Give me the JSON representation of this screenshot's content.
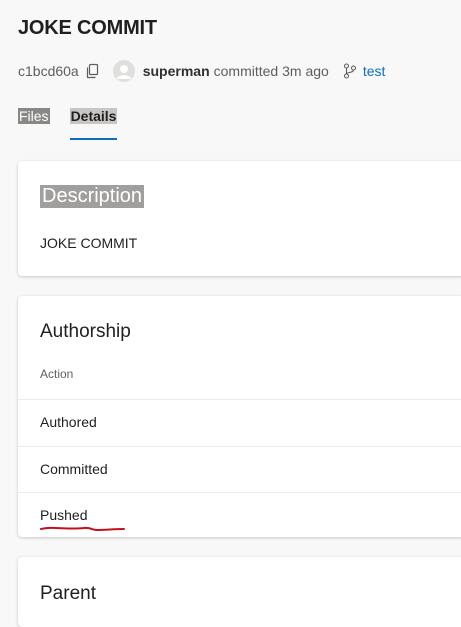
{
  "commit": {
    "title": "JOKE COMMIT",
    "hash": "c1bcd60a",
    "author": "superman",
    "action_time": "committed 3m ago",
    "branch": "test"
  },
  "tabs": [
    {
      "label": "Files"
    },
    {
      "label": "Details"
    }
  ],
  "description": {
    "heading": "Description",
    "text": "JOKE COMMIT"
  },
  "authorship": {
    "heading": "Authorship",
    "column_header": "Action",
    "rows": [
      "Authored",
      "Committed",
      "Pushed"
    ]
  },
  "parent": {
    "heading": "Parent"
  },
  "colors": {
    "accent": "#0f6cbd",
    "annotation": "#c50f1f"
  },
  "icons": {
    "copy": "copy-icon",
    "avatar": "avatar-icon",
    "branch": "branch-icon"
  }
}
